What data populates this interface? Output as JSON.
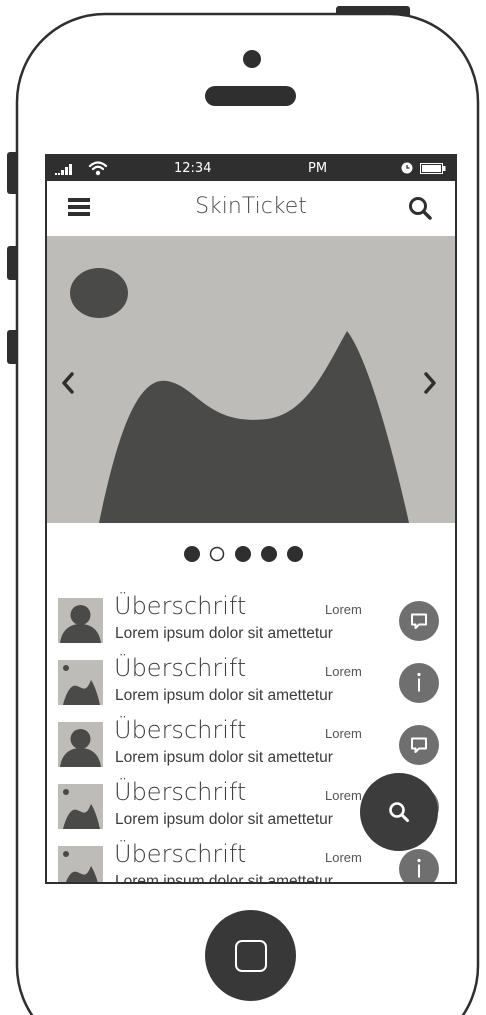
{
  "status_bar": {
    "time": "12:34",
    "ampm": "PM"
  },
  "app_bar": {
    "title": "SkinTicket"
  },
  "carousel": {
    "slides": 5,
    "active_index": 1
  },
  "list": {
    "items": [
      {
        "heading": "Überschrift",
        "meta": "Lorem",
        "description": "Lorem ipsum dolor sit amettetur",
        "thumbnail": "avatar",
        "action": "comment-icon"
      },
      {
        "heading": "Überschrift",
        "meta": "Lorem",
        "description": "Lorem ipsum dolor sit amettetur",
        "thumbnail": "image",
        "action": "info-icon"
      },
      {
        "heading": "Überschrift",
        "meta": "Lorem",
        "description": "Lorem ipsum dolor sit amettetur",
        "thumbnail": "avatar",
        "action": "comment-icon"
      },
      {
        "heading": "Überschrift",
        "meta": "Lorem",
        "description": "Lorem ipsum dolor sit amettetur",
        "thumbnail": "image",
        "action": "search-icon"
      },
      {
        "heading": "Überschrift",
        "meta": "Lorem",
        "description": "Lorem ipsum dolor sit amettetur",
        "thumbnail": "image",
        "action": "info-icon"
      }
    ]
  },
  "fab": {
    "icon": "search-icon"
  },
  "colors": {
    "status_bar": "#2f2f2f",
    "placeholder": "#bdbcb8",
    "dark": "#4a4a49",
    "action_button": "#6f6f6f",
    "fab": "#3c3c3c"
  }
}
